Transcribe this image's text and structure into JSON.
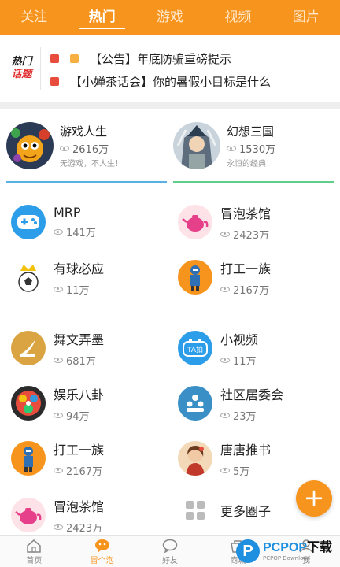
{
  "top_tabs": [
    {
      "label": "关注",
      "active": false
    },
    {
      "label": "热门",
      "active": true
    },
    {
      "label": "游戏",
      "active": false
    },
    {
      "label": "视频",
      "active": false
    },
    {
      "label": "图片",
      "active": false
    }
  ],
  "topics": {
    "logo_line1": "热门",
    "logo_line2": "话题",
    "items": [
      {
        "text": "【公告】年底防骗重磅提示",
        "badges": [
          "hot",
          "new"
        ]
      },
      {
        "text": "【小婵茶话会】你的暑假小目标是什么",
        "badges": [
          "hot"
        ]
      }
    ]
  },
  "featured": [
    {
      "name": "游戏人生",
      "count": "2616万",
      "slogan": "无游戏，不人生！"
    },
    {
      "name": "幻想三国",
      "count": "1530万",
      "slogan": "永恒的经典！"
    }
  ],
  "circles": [
    {
      "name": "MRP",
      "count": "141万",
      "icon": "gamepad-icon"
    },
    {
      "name": "冒泡茶馆",
      "count": "2423万",
      "icon": "teapot-icon"
    },
    {
      "name": "有球必应",
      "count": "11万",
      "icon": "soccer-ball-icon"
    },
    {
      "name": "打工一族",
      "count": "2167万",
      "icon": "worker-icon"
    },
    {
      "name": "舞文弄墨",
      "count": "681万",
      "icon": "quill-icon"
    },
    {
      "name": "小视频",
      "count": "11万",
      "icon": "ta-video-icon"
    },
    {
      "name": "娱乐八卦",
      "count": "94万",
      "icon": "entertainment-icon"
    },
    {
      "name": "社区居委会",
      "count": "23万",
      "icon": "community-icon"
    },
    {
      "name": "打工一族",
      "count": "2167万",
      "icon": "worker-icon"
    },
    {
      "name": "唐唐推书",
      "count": "5万",
      "icon": "book-lady-icon"
    },
    {
      "name": "冒泡茶馆",
      "count": "2423万",
      "icon": "teapot-icon"
    },
    {
      "name": "更多圈子",
      "count": "",
      "icon": "grid-icon"
    }
  ],
  "fab_label": "+",
  "bottom_nav": [
    {
      "label": "首页",
      "icon": "home-icon",
      "active": false
    },
    {
      "label": "冒个泡",
      "icon": "bubble-icon",
      "active": true
    },
    {
      "label": "好友",
      "icon": "chat-icon",
      "active": false
    },
    {
      "label": "商城",
      "icon": "shop-icon",
      "active": false
    },
    {
      "label": "我",
      "icon": "profile-icon",
      "active": false
    }
  ],
  "watermark": {
    "brand_blue": "PCPOP",
    "brand_black": "下载",
    "sub": "PCPOP Download"
  },
  "colors": {
    "accent": "#f7941d",
    "left_line": "#5ab1e8",
    "right_line": "#62cc8a"
  }
}
